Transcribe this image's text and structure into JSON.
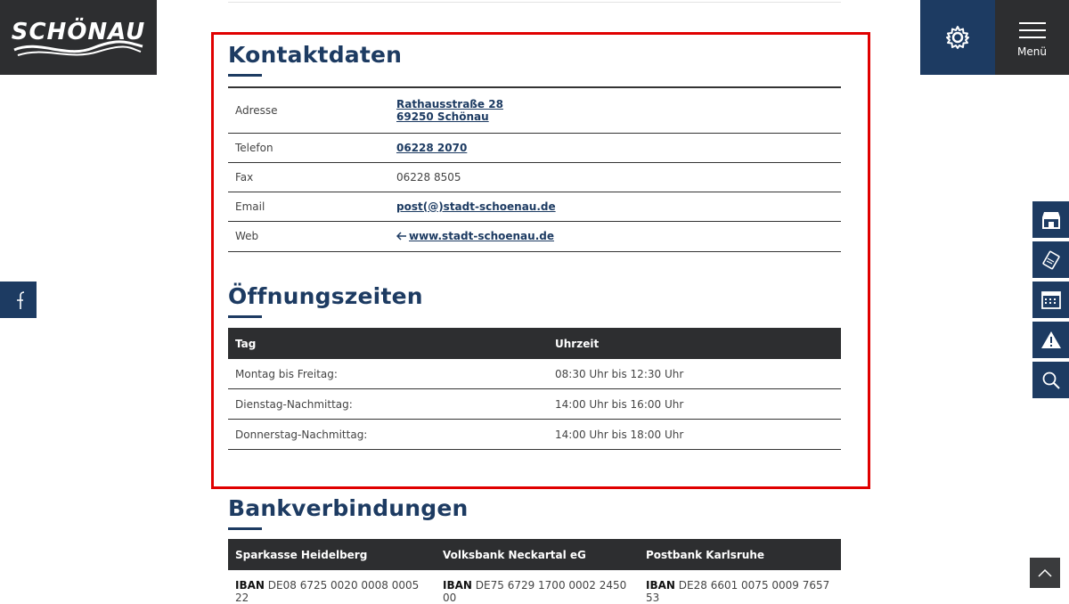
{
  "logo": {
    "text": "SCHÖNAU"
  },
  "header": {
    "menu_label": "Menü"
  },
  "kontakt": {
    "title": "Kontaktdaten",
    "rows": [
      {
        "key": "Adresse",
        "value_line1": "Rathausstraße 28",
        "value_line2": "69250 Schönau"
      },
      {
        "key": "Telefon",
        "value": "06228 2070"
      },
      {
        "key": "Fax",
        "value": "06228 8505"
      },
      {
        "key": "Email",
        "value": "post(@)stadt-schoenau.de"
      },
      {
        "key": "Web",
        "value": "www.stadt-schoenau.de"
      }
    ]
  },
  "hours": {
    "title": "Öffnungszeiten",
    "headers": [
      "Tag",
      "Uhrzeit"
    ],
    "rows": [
      {
        "day": "Montag bis Freitag:",
        "time": "08:30 Uhr bis 12:30 Uhr"
      },
      {
        "day": "Dienstag-Nachmittag:",
        "time": "14:00 Uhr bis 16:00 Uhr"
      },
      {
        "day": "Donnerstag-Nachmittag:",
        "time": "14:00 Uhr bis 18:00 Uhr"
      }
    ]
  },
  "bank": {
    "title": "Bankverbindungen",
    "headers": [
      "Sparkasse Heidelberg",
      "Volksbank Neckartal eG",
      "Postbank Karlsruhe"
    ],
    "iban_label": "IBAN",
    "ibans": [
      "DE08 6725 0020 0008 0005 22",
      "DE75 6729 1700 0002 2450 00",
      "DE28 6601 0075 0009 7657 53"
    ]
  },
  "colors": {
    "brand_blue": "#1d3b62",
    "dark": "#2d2e30",
    "highlight": "#e00000"
  },
  "icons": {
    "settings": "gear-icon",
    "menu": "hamburger-icon",
    "facebook": "facebook-icon",
    "side": [
      "store-icon",
      "ticket-icon",
      "calendar-icon",
      "warning-icon",
      "search-icon"
    ],
    "scroll": "chevron-up-icon",
    "web": "arrow-left-icon"
  }
}
